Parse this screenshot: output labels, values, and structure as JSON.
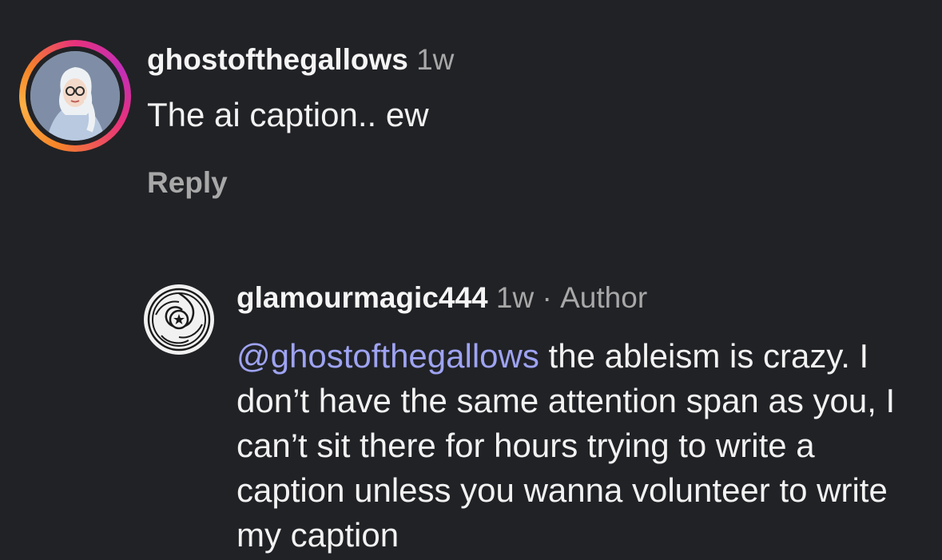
{
  "comment": {
    "username": "ghostofthegallows",
    "time": "1w",
    "text": "The ai caption.. ew",
    "reply_label": "Reply"
  },
  "reply": {
    "username": "glamourmagic444",
    "time": "1w",
    "separator": "·",
    "author_badge": "Author",
    "mention": "@ghostofthegallows",
    "text": "the ableism is crazy. I don’t have the same attention span as you, I can’t sit there for hours trying to write a caption unless you wanna volunteer to write my caption"
  },
  "colors": {
    "background": "#212226",
    "mention": "#9ea3f2",
    "meta": "#a8a8a8",
    "story_ring": [
      "#e8317c",
      "#c22fb8",
      "#f58529",
      "#fcb045"
    ]
  },
  "icons": {
    "comment_avatar": "avatar-with-story-ring",
    "reply_avatar": "hecate-wheel-logo"
  }
}
